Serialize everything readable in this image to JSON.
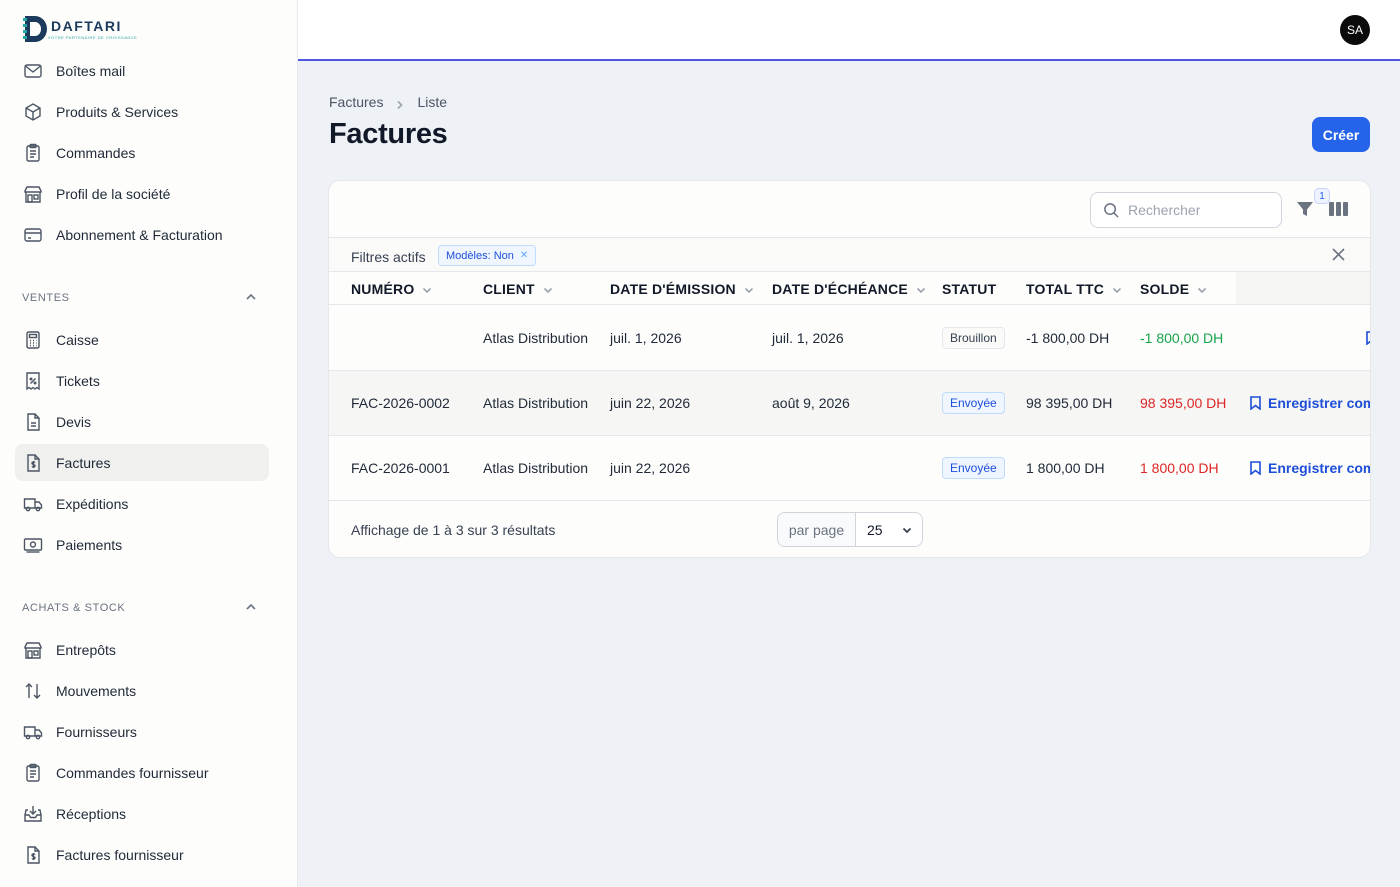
{
  "brand": {
    "name": "DAFTARI",
    "tagline": "VOTRE PARTENAIRE DE CROISSANCE"
  },
  "user": {
    "initials": "SA"
  },
  "sidebar": {
    "top_items": [
      {
        "label": "Boîtes mail",
        "icon": "mail-icon"
      },
      {
        "label": "Produits & Services",
        "icon": "cube-icon"
      },
      {
        "label": "Commandes",
        "icon": "clipboard-icon"
      },
      {
        "label": "Profil de la société",
        "icon": "store-icon"
      },
      {
        "label": "Abonnement & Facturation",
        "icon": "credit-card-icon"
      }
    ],
    "sections": [
      {
        "title": "VENTES",
        "items": [
          {
            "label": "Caisse",
            "icon": "calculator-icon"
          },
          {
            "label": "Tickets",
            "icon": "receipt-percent-icon"
          },
          {
            "label": "Devis",
            "icon": "document-icon"
          },
          {
            "label": "Factures",
            "icon": "invoice-dollar-icon",
            "active": true
          },
          {
            "label": "Expéditions",
            "icon": "truck-icon"
          },
          {
            "label": "Paiements",
            "icon": "banknote-icon"
          }
        ]
      },
      {
        "title": "ACHATS & STOCK",
        "items": [
          {
            "label": "Entrepôts",
            "icon": "store-icon"
          },
          {
            "label": "Mouvements",
            "icon": "arrows-up-down-icon"
          },
          {
            "label": "Fournisseurs",
            "icon": "truck-icon"
          },
          {
            "label": "Commandes fournisseur",
            "icon": "clipboard-icon"
          },
          {
            "label": "Réceptions",
            "icon": "inbox-download-icon"
          },
          {
            "label": "Factures fournisseur",
            "icon": "invoice-dollar-icon"
          }
        ]
      }
    ]
  },
  "breadcrumb": {
    "first": "Factures",
    "second": "Liste"
  },
  "page": {
    "title": "Factures",
    "create_label": "Créer"
  },
  "toolbar": {
    "search_placeholder": "Rechercher",
    "filter_count": "1"
  },
  "filters": {
    "label": "Filtres actifs",
    "chips": [
      {
        "label": "Modèles: Non"
      }
    ]
  },
  "table": {
    "columns": [
      "NUMÉRO",
      "CLIENT",
      "DATE D'ÉMISSION",
      "DATE D'ÉCHÉANCE",
      "STATUT",
      "TOTAL TTC",
      "SOLDE"
    ],
    "rows": [
      {
        "numero": "",
        "client": "Atlas Distribution",
        "emission": "juil. 1, 2026",
        "echeance": "juil. 1, 2026",
        "statut": "Brouillon",
        "total": "-1 800,00 DH",
        "solde": "-1 800,00 DH",
        "action": ""
      },
      {
        "numero": "FAC-2026-0002",
        "client": "Atlas Distribution",
        "emission": "juin 22, 2026",
        "echeance": "août 9, 2026",
        "statut": "Envoyée",
        "total": "98 395,00 DH",
        "solde": "98 395,00 DH",
        "action": "Enregistrer comm"
      },
      {
        "numero": "FAC-2026-0001",
        "client": "Atlas Distribution",
        "emission": "juin 22, 2026",
        "echeance": "",
        "statut": "Envoyée",
        "total": "1 800,00 DH",
        "solde": "1 800,00 DH",
        "action": "Enregistrer comm"
      }
    ]
  },
  "pagination": {
    "summary": "Affichage de 1 à 3 sur 3 résultats",
    "per_page_label": "par page",
    "per_page_value": "25"
  },
  "colors": {
    "accent": "#2563eb",
    "header_line": "#4f57e0",
    "positive": "#16a34a",
    "negative": "#dc2626"
  }
}
